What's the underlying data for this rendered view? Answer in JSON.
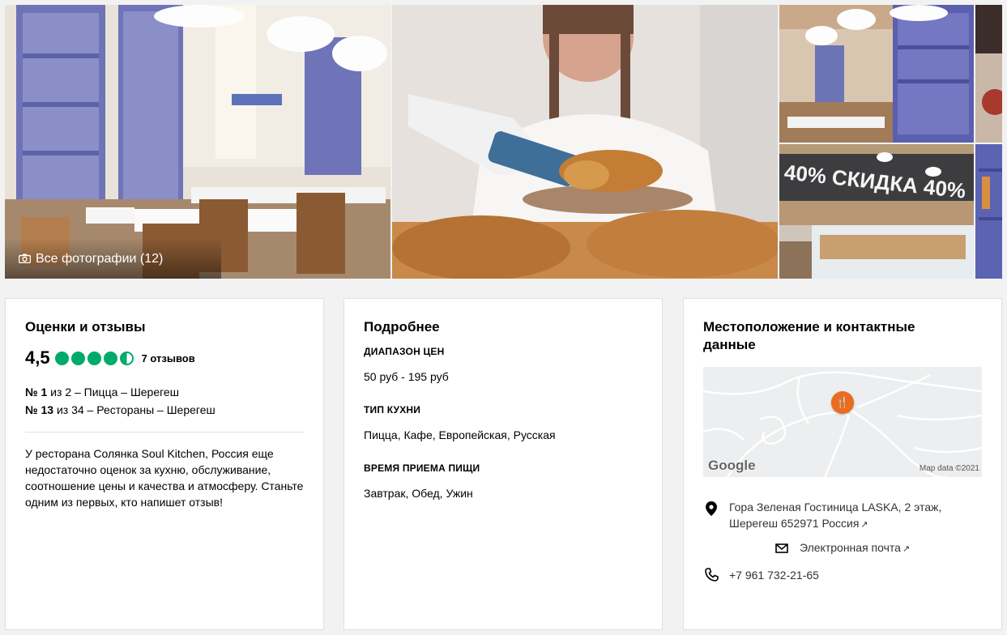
{
  "gallery": {
    "all_photos_label": "Все фотографии (12)",
    "photos": [
      "restaurant-interior",
      "croissant-serving",
      "dining-hall",
      "sale-counter",
      "side-photo-1",
      "side-photo-2"
    ],
    "promo_sign": "40% СКИДКА 40%"
  },
  "ratings": {
    "title": "Оценки и отзывы",
    "score": "4,5",
    "bubbles_value": 4.5,
    "bubbles_max": 5,
    "reviews": "7 отзывов",
    "rank1_num": "№ 1",
    "rank1_text": " из 2 – Пицца – Шерегеш",
    "rank2_num": "№ 13",
    "rank2_text": " из 34 – Рестораны – Шерегеш",
    "description": "У ресторана Солянка Soul Kitchen, Россия еще недостаточно оценок за кухню, обслуживание, соотношение цены и качества и атмосферу. Станьте одним из первых, кто напишет отзыв!",
    "accent_color": "#00aa6c"
  },
  "details": {
    "title": "Подробнее",
    "price_label": "ДИАПАЗОН ЦЕН",
    "price_value": "50 руб - 195 руб",
    "cuisine_label": "ТИП КУХНИ",
    "cuisine_value": "Пицца, Кафе, Европейская, Русская",
    "meals_label": "ВРЕМЯ ПРИЕМА ПИЩИ",
    "meals_value": "Завтрак, Обед, Ужин"
  },
  "location": {
    "title": "Местоположение и контактные данные",
    "map_logo": "Google",
    "map_credit": "Map data ©2021",
    "pin_color": "#ea6c1f",
    "address_line1": "Гора Зеленая Гостиница LASKA, 2 этаж,",
    "address_line2": "Шерегеш 652971 Россия",
    "email": "Электронная почта",
    "phone": "+7 961 732-21-65"
  }
}
